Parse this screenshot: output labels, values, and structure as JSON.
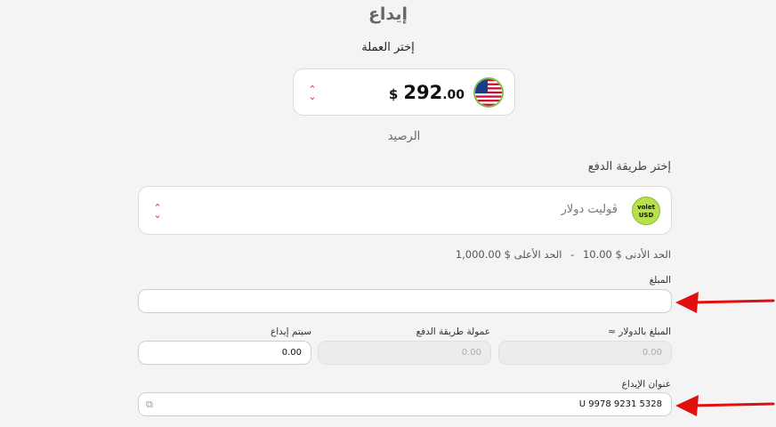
{
  "page": {
    "title": "إيداع"
  },
  "currency": {
    "label": "إختر العملة",
    "amount_int": "292",
    "amount_dec": ".00",
    "symbol": "$",
    "flag": "us-flag-icon",
    "balance_label": "الرصيد"
  },
  "payment": {
    "label": "إختر طريقة الدفع",
    "method_name": "ڤوليت دولار",
    "logo_line1": "volet",
    "logo_line2": "USD",
    "min_label": "الحد الأدنى",
    "min_value": "10.00 $",
    "separator": "-",
    "max_label": "الحد الأعلى",
    "max_value": "1,000.00 $"
  },
  "form": {
    "amount_label": "المبلغ",
    "amount_value": "",
    "usd_label": "المبلغ بالدولار ≈",
    "usd_value": "0.00",
    "fee_label": "عمولة طريقة الدفع",
    "fee_value": "0.00",
    "deposit_label": "سيتم إيداع",
    "deposit_value": "0.00",
    "address_label": "عنوان الإيداع",
    "address_value": "U 9978 9231 5328"
  },
  "colors": {
    "arrow": "#e01010",
    "accent_green": "#b8e04a",
    "sort_icon": "#e03030"
  }
}
